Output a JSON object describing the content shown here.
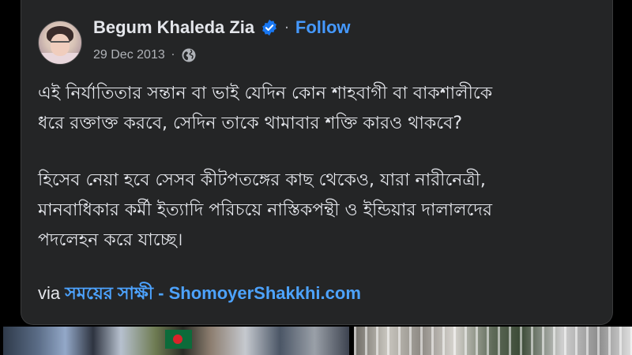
{
  "post": {
    "author": "Begum Khaleda Zia",
    "follow_label": "Follow",
    "date": "29 Dec 2013",
    "meta_separator": "·",
    "name_separator": "·",
    "paragraph1": "এই নির্যাতিতার সন্তান বা ভাই যেদিন কোন শাহবাগী বা বাকশালীকে\nধরে রক্তাক্ত করবে, সেদিন তাকে থামাবার শক্তি কারও থাকবে?",
    "paragraph2": "হিসেব নেয়া হবে সেসব কীটপতঙ্গের কাছ থেকেও, যারা নারীনেত্রী,\nমানবাধিকার কর্মী ইত্যাদি পরিচয়ে নাস্তিকপন্থী ও ইন্ডিয়ার দালালদের\nপদলেহন করে যাচ্ছে।",
    "via_label": "via",
    "via_link": "সময়ের সাক্ষী - ShomoyerShakkhi.com"
  },
  "icons": {
    "verified": "verified-badge-icon",
    "privacy": "globe-icon"
  },
  "colors": {
    "background": "#000000",
    "card": "#242526",
    "text": "#e4e6eb",
    "secondary_text": "#b0b3b8",
    "link": "#4da3ff",
    "verified": "#1877f2"
  }
}
